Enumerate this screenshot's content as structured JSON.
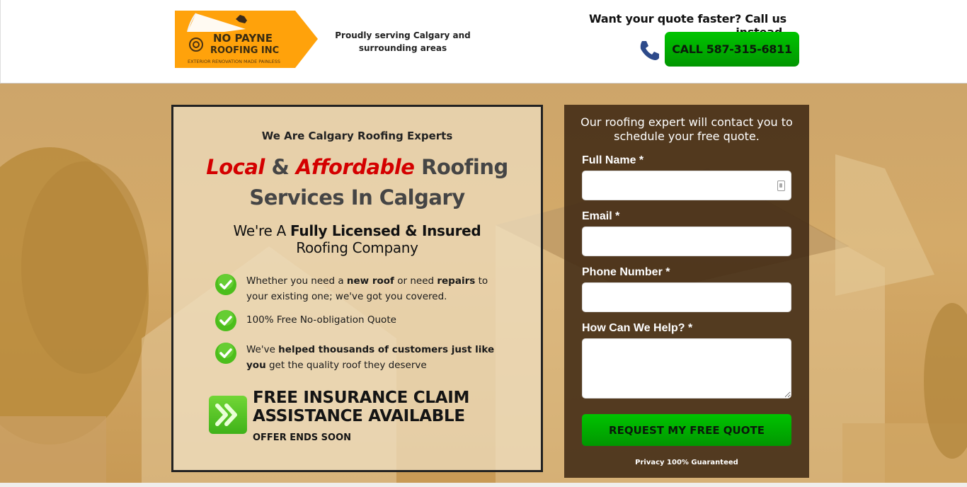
{
  "header": {
    "logo": {
      "line1": "NO PAYNE",
      "line2": "ROOFING INC",
      "tagline": "EXTERIOR RENOVATION MADE PAINLESS",
      "bg_color": "#ffa20b"
    },
    "service_area": "Proudly serving Calgary and surrounding areas",
    "cta_heading": "Want your quote faster? Call us instead.",
    "call_button": "CALL 587-315-6811",
    "phone_icon": "phone-icon"
  },
  "hero": {
    "card": {
      "kicker": "We Are Calgary Roofing Experts",
      "headline": {
        "red1": "Local",
        "amp": "&",
        "red2": "Affordable",
        "rest1": "Roofing",
        "line2": "Services In Calgary"
      },
      "sub": {
        "pre": "We're A",
        "bold": "Fully Licensed & Insured",
        "line2": "Roofing Company"
      },
      "features": [
        {
          "icon": "check-icon",
          "parts": [
            {
              "t": "Whether you need a ",
              "b": false
            },
            {
              "t": "new roof",
              "b": true
            },
            {
              "t": " or need ",
              "b": false
            },
            {
              "t": "repairs",
              "b": true
            },
            {
              "t": " to your existing one; we've got you covered.",
              "b": false
            }
          ]
        },
        {
          "icon": "check-icon",
          "parts": [
            {
              "t": "100% Free No-obligation Quote",
              "b": false
            }
          ]
        },
        {
          "icon": "check-icon",
          "parts": [
            {
              "t": "We've ",
              "b": false
            },
            {
              "t": "helped thousands of customers just like you",
              "b": true
            },
            {
              "t": " get the quality roof they deserve",
              "b": false
            }
          ]
        }
      ],
      "promo": {
        "icon": "double-chevron-right-icon",
        "title_line1": "FREE INSURANCE CLAIM",
        "title_line2": "ASSISTANCE AVAILABLE",
        "sub": "OFFER ENDS SOON"
      }
    },
    "form": {
      "intro": "Our roofing expert will contact you to schedule your free quote.",
      "fields": [
        {
          "label": "Full Name *",
          "value": "",
          "placeholder": ""
        },
        {
          "label": "Email *",
          "value": "",
          "placeholder": ""
        },
        {
          "label": "Phone Number *",
          "value": "",
          "placeholder": ""
        },
        {
          "label": "How Can We Help? *",
          "value": "",
          "placeholder": ""
        }
      ],
      "submit": "REQUEST MY FREE QUOTE",
      "privacy": "Privacy 100% Guaranteed"
    }
  },
  "colors": {
    "accent_green": "#00b400",
    "headline_red": "#d40000",
    "hero_tint": "#cda56a",
    "form_bg": "#3c2612"
  }
}
